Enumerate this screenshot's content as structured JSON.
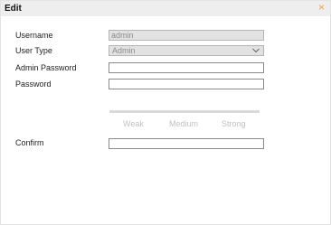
{
  "dialog": {
    "title": "Edit",
    "close_glyph": "×"
  },
  "form": {
    "username": {
      "label": "Username",
      "value": "admin"
    },
    "user_type": {
      "label": "User Type",
      "value": "Admin"
    },
    "admin_password": {
      "label": "Admin Password",
      "value": ""
    },
    "password": {
      "label": "Password",
      "value": ""
    },
    "strength": {
      "weak": "Weak",
      "medium": "Medium",
      "strong": "Strong"
    },
    "confirm": {
      "label": "Confirm",
      "value": ""
    }
  },
  "colors": {
    "close_icon": "#f0a050",
    "titlebar_bg": "#eeeeee",
    "disabled_bg": "#e2e2e2",
    "strength_text": "#c2c2c2"
  }
}
